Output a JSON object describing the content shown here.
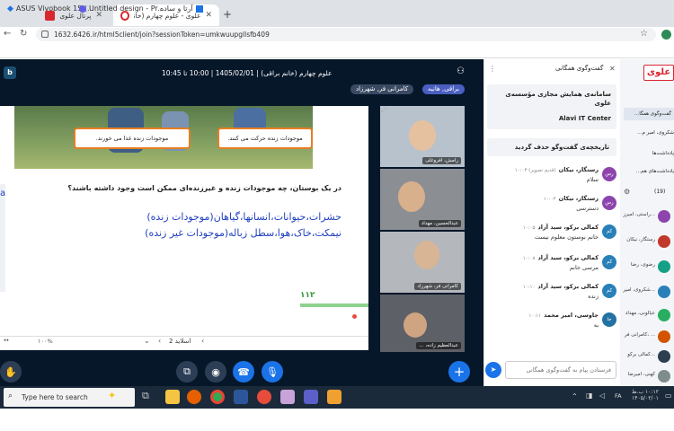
{
  "browser": {
    "tabs": [
      {
        "title": "پرتال علوی",
        "active": false
      },
      {
        "title": "علوی - علوم چهارم (خانم براق...",
        "active": true
      }
    ],
    "new_tab": "+",
    "url": "1632.6426.ir/html5client/join?sessionToken=umkwuupgllsfb409",
    "bookmarks": [
      "ASUS Vivobook 15 (...",
      "Untitled design - Pr...",
      "آرتا و ساده"
    ]
  },
  "meeting": {
    "title": "علوم چهارم (خانم براقی) | 1405/02/01 | 10:00 تا 10:45",
    "presenter_chip": "براقی, هانیه",
    "talker_chip": "کامرانی فر, شهرزاد",
    "slide": {
      "caption_left": "موجودات زنده غذا می خورند.",
      "caption_right": "موجودات زنده حرکت می کنند.",
      "question": "در یک بوستان، چه موجودات زنده و غیرزنده‌ای ممکن است وجود داشته باشند؟",
      "answer_line1": "حشرات،حیوانات،انسانها،گیاهان(موجودات زنده)",
      "answer_line2": "نیمکت،خاک،هوا،سطل زباله(موجودات غیر زنده)",
      "page_number": "۱۱۲",
      "nav_label": "اسلاید 2",
      "zoom": "۱۰۰%"
    },
    "videos": [
      {
        "name": "رامش، افروغلی"
      },
      {
        "name": "عبدالحسین، مهداد"
      },
      {
        "name": "کامرانی فر، شهرزاد"
      },
      {
        "name": "عبدالعظیم زاده، ..."
      }
    ]
  },
  "chat": {
    "title": "گفت‌وگوی همگانی",
    "welcome_title": "سامانه‌ی همایش مجازی مؤسسه‌ی علوی",
    "welcome_sub": "Alavi IT Center",
    "cleared": "تاریخچه‌ی گفت‌وگو حذف گردید",
    "messages": [
      {
        "initials": "رس",
        "name": "رستگار، نیکان",
        "time": "(قدیم تصویر) ۱۰:۰۳",
        "text": "سلام",
        "color": "#8e44ad"
      },
      {
        "initials": "رس",
        "name": "رستگار، نیکان",
        "time": "۱۰:۰۴",
        "text": "دسترسی",
        "color": "#8e44ad"
      },
      {
        "initials": "کم",
        "name": "کمالی برکو، سید آراد",
        "time": "۱۰:۰۵",
        "text": "خانم بوستون معلوم نیست",
        "color": "#2980b9"
      },
      {
        "initials": "کم",
        "name": "کمالی برکو، سید آراد",
        "time": "۱۰:۰۸",
        "text": "مرسی خانم",
        "color": "#2980b9"
      },
      {
        "initials": "کم",
        "name": "کمالی برکو، سید آراد",
        "time": "۱۰:۱۰",
        "text": "زنده",
        "color": "#2980b9"
      },
      {
        "initials": "جا",
        "name": "جاوسی، امیر محمد",
        "time": "۱۰:۱۱",
        "text": "به",
        "color": "#2471a3"
      }
    ],
    "input_placeholder": "فرستادن پیام به گفت‌وگوی همگانی"
  },
  "sidebar": {
    "brand": "علوی",
    "sections": [
      "گفت‌وگوی همگا...",
      "شکروی، امیر م...",
      "پادداشت‌ها",
      "یادداشت‌های هم..."
    ],
    "users_count": "(19)",
    "users": [
      {
        "name": "راستی، امیرز...",
        "color": "#8e44ad"
      },
      {
        "name": "رستگار، نیکان",
        "color": "#c0392b"
      },
      {
        "name": "رضوی، رضا",
        "color": "#16a085"
      },
      {
        "name": "شکروی، امیر...",
        "color": "#2980b9"
      },
      {
        "name": "عبالونی، مهداد",
        "color": "#27ae60"
      },
      {
        "name": "کامرانی فر، ...",
        "color": "#d35400"
      },
      {
        "name": "کمالی برکو...",
        "color": "#2c3e50"
      },
      {
        "name": "کهنی، امیرضا",
        "color": "#7f8c8d"
      }
    ]
  },
  "taskbar": {
    "search_placeholder": "Type here to search",
    "time": "۱۰:۱۲ ب.ظ",
    "date": "۱۴۰۵/۰۲/۰۱",
    "lang": "FA"
  }
}
